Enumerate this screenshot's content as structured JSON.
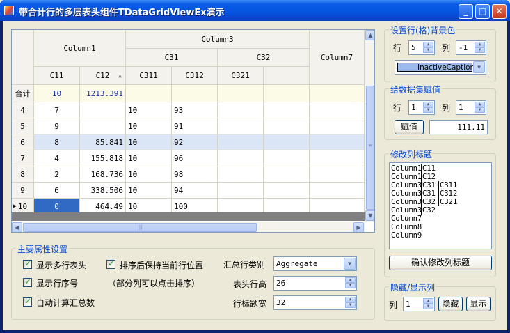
{
  "window": {
    "title": "带合计行的多层表头组件TDataGridViewEx演示",
    "minimize": "_",
    "maximize": "□",
    "close": "✕"
  },
  "grid": {
    "header": {
      "column1": "Column1",
      "column3": "Column3",
      "c31": "C31",
      "c32": "C32",
      "column7": "Column7",
      "c11": "C11",
      "c12": "C12",
      "c311": "C311",
      "c312": "C312",
      "c321": "C321",
      "sort_glyph": "▲"
    },
    "summary": {
      "label": "合计",
      "c11": "10",
      "c12": "1213.391"
    },
    "rows": [
      {
        "rowno": "4",
        "c11": "7",
        "c12": "",
        "c311": "10",
        "c312": "93"
      },
      {
        "rowno": "5",
        "c11": "9",
        "c12": "",
        "c311": "10",
        "c312": "91"
      },
      {
        "rowno": "6",
        "c11": "8",
        "c12": "85.841",
        "c311": "10",
        "c312": "92"
      },
      {
        "rowno": "7",
        "c11": "4",
        "c12": "155.818",
        "c311": "10",
        "c312": "96"
      },
      {
        "rowno": "8",
        "c11": "2",
        "c12": "168.736",
        "c311": "10",
        "c312": "98"
      },
      {
        "rowno": "9",
        "c11": "6",
        "c12": "338.506",
        "c311": "10",
        "c312": "94"
      },
      {
        "rowno": "10",
        "c11": "0",
        "c12": "464.49",
        "c311": "10",
        "c312": "100"
      }
    ],
    "current_row_marker": "▶",
    "hscroll_grip": "|||",
    "vscroll_grip": "≡",
    "arrow_up": "▲",
    "arrow_down": "▼",
    "arrow_left": "◀",
    "arrow_right": "▶"
  },
  "bgcolor_group": {
    "title": "设置行(格)背景色",
    "row_label": "行",
    "row_value": "5",
    "col_label": "列",
    "col_value": "-1",
    "color_value": "InactiveCaption",
    "color_swatch": "#9db9eb"
  },
  "assign_group": {
    "title": "给数据集赋值",
    "row_label": "行",
    "row_value": "1",
    "col_label": "列",
    "col_value": "1",
    "assign_button": "赋值",
    "value": "111.11"
  },
  "caption_group": {
    "title": "修改列标题",
    "lines": [
      [
        "Column1",
        "C11",
        ""
      ],
      [
        "Column1",
        "C12",
        ""
      ],
      [
        "Column3",
        "C31",
        "C311"
      ],
      [
        "Column3",
        "C31",
        "C312"
      ],
      [
        "Column3",
        "C32",
        "C321"
      ],
      [
        "Column3",
        "C32",
        ""
      ],
      [
        "Column7",
        "",
        ""
      ],
      [
        "Column8",
        "",
        ""
      ],
      [
        "Column9",
        "",
        ""
      ]
    ],
    "confirm_button": "确认修改列标题"
  },
  "hide_group": {
    "title": "隐藏/显示列",
    "col_label": "列",
    "col_value": "1",
    "hide_button": "隐藏",
    "show_button": "显示"
  },
  "props_group": {
    "title": "主要属性设置",
    "chk_multi_header": "显示多行表头",
    "chk_row_number": "显示行序号",
    "chk_auto_sum": "自动计算汇总数",
    "chk_keep_row": "排序后保持当前行位置",
    "note": "（部分列可以点击排序）",
    "sum_type_label": "汇总行类别",
    "sum_type_value": "Aggregate",
    "header_height_label": "表头行高",
    "header_height_value": "26",
    "row_header_width_label": "行标题宽",
    "row_header_width_value": "32"
  }
}
